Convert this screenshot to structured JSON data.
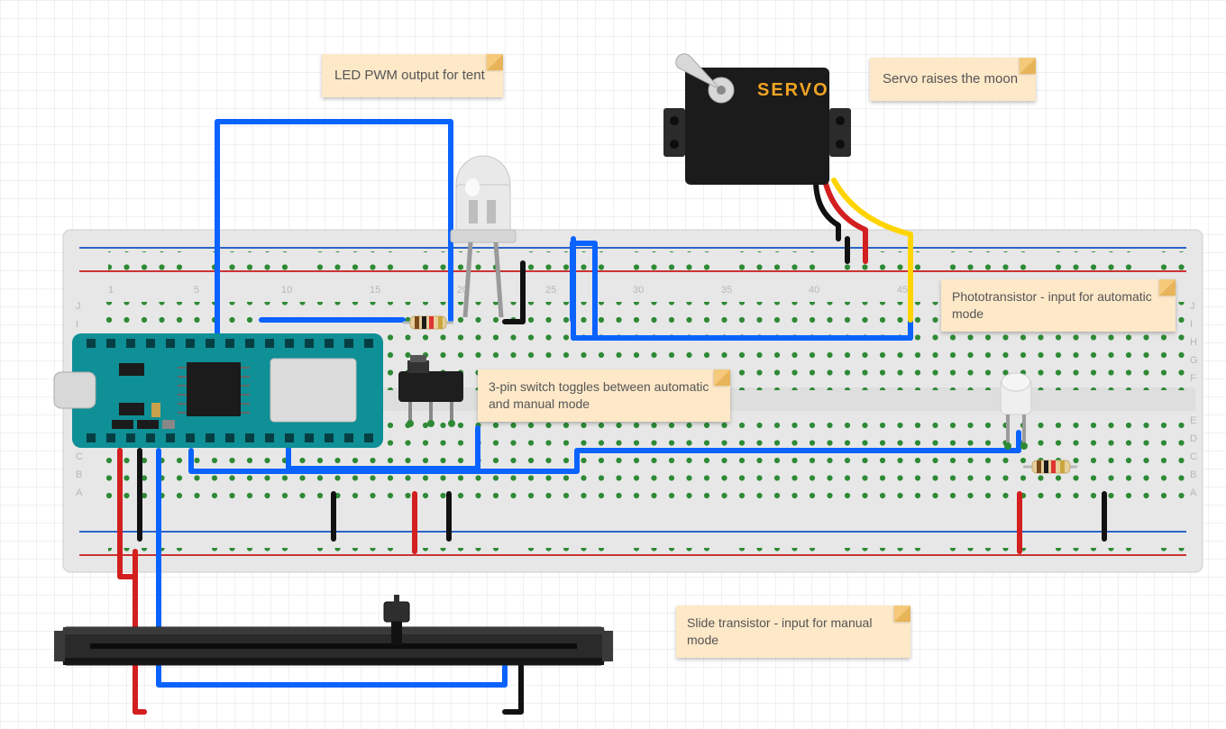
{
  "notes": {
    "led": "LED PWM output for tent",
    "servo": "Servo raises the moon",
    "photo": "Phototransistor - input for automatic mode",
    "switch": "3-pin switch toggles between automatic and manual mode",
    "slide": "Slide transistor - input for manual mode"
  },
  "servo_label": "SERVO",
  "components": {
    "breadboard": "full-size breadboard",
    "mcu": "Arduino Nano-style microcontroller (USB-C)",
    "led": "10mm white LED",
    "servo": "micro servo motor",
    "switch": "3-pin slide switch",
    "phototransistor": "phototransistor with resistor divider",
    "resistors": "two through-hole resistors",
    "slide_pot": "long slide potentiometer"
  },
  "wiring": {
    "blue": [
      "MCU digital → LED anode",
      "MCU digital → switch common",
      "MCU digital → servo signal",
      "MCU analog → phototransistor",
      "MCU analog → slide pot wiper"
    ],
    "red": [
      "MCU 5V → bottom + rail",
      "bottom + rail → slide pot V+",
      "top + rail → servo V+",
      "bottom + rail → photo V+"
    ],
    "black": [
      "MCU GND → rails",
      "LED cathode → top − rail",
      "switch pole → rail",
      "slide pot GND → bottom − rail",
      "servo GND → top − rail",
      "photo GND → bottom − rail"
    ],
    "yellow": [
      "servo signal lead → breadboard"
    ]
  }
}
